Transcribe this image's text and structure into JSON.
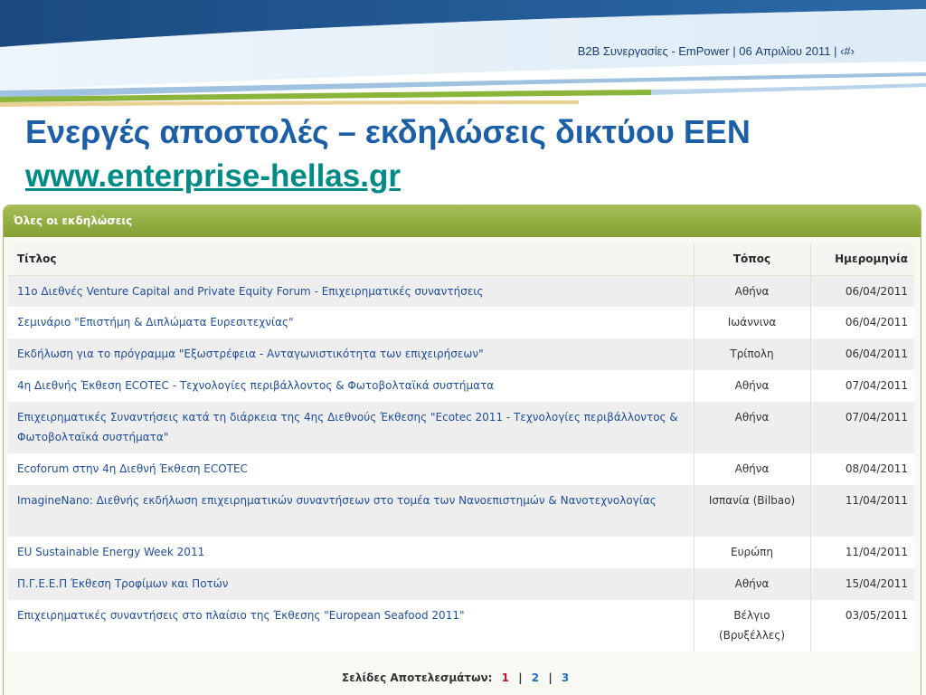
{
  "slide": {
    "header_text": "B2B Συνεργασίες - EmPower  | 06 Απριλίου 2011 | ‹#›",
    "title": "Ενεργές αποστολές – εκδηλώσεις δικτύου ΕΕΝ",
    "link": "www.enterprise-hellas.gr"
  },
  "colors": {
    "title_blue": "#1c5fa6",
    "link_teal": "#008b85",
    "banner_navy": "#1a4a80",
    "banner_green": "#8ab43a",
    "panel_green": "#9bb548",
    "link_blue": "#1f4e99",
    "current_page_red": "#c8102e"
  },
  "panel": {
    "heading": "Όλες οι εκδηλώσεις",
    "columns": [
      "Τίτλος",
      "Τόπος",
      "Ημερομηνία"
    ],
    "rows": [
      {
        "title": "11ο Διεθνές Venture Capital and Private Equity Forum - Επιχειρηματικές συναντήσεις",
        "place": "Αθήνα",
        "date": "06/04/2011"
      },
      {
        "title": "Σεμινάριο \"Επιστήμη & Διπλώματα Ευρεσιτεχνίας\"",
        "place": "Ιωάννινα",
        "date": "06/04/2011"
      },
      {
        "title": "Εκδήλωση για το πρόγραμμα \"Εξωστρέφεια - Ανταγωνιστικότητα των επιχειρήσεων\"",
        "place": "Τρίπολη",
        "date": "06/04/2011"
      },
      {
        "title": "4η Διεθνής Έκθεση ECOTEC - Τεχνολογίες περιβάλλοντος & Φωτοβολταϊκά συστήματα",
        "place": "Αθήνα",
        "date": "07/04/2011"
      },
      {
        "title": "Επιχειρηματικές Συναντήσεις κατά τη διάρκεια της 4ης Διεθνούς Έκθεσης \"Ecotec 2011 - Τεχνολογίες περιβάλλοντος & Φωτοβολταϊκά συστήματα\"",
        "place": "Αθήνα",
        "date": "07/04/2011"
      },
      {
        "title": "Ecoforum στην 4η Διεθνή Έκθεση ECOTEC",
        "place": "Αθήνα",
        "date": "08/04/2011"
      },
      {
        "title": "ImagineNano: Διεθνής εκδήλωση επιχειρηματικών συναντήσεων στο τομέα των Νανοεπιστημών & Νανοτεχνολογίας",
        "place": "Ισπανία (Bilbao)",
        "date": "11/04/2011"
      },
      {
        "title": "EU Sustainable Energy Week 2011",
        "place": "Ευρώπη",
        "date": "11/04/2011"
      },
      {
        "title": "Π.Γ.Ε.Ε.Π Έκθεση Τροφίμων και Ποτών",
        "place": "Αθήνα",
        "date": "15/04/2011"
      },
      {
        "title": "Επιχειρηματικές συναντήσεις στο πλαίσιο της Έκθεσης \"European Seafood 2011\"",
        "place": "Βέλγιο (Βρυξέλλες)",
        "date": "03/05/2011"
      }
    ],
    "pagination": {
      "label": "Σελίδες Αποτελεσμάτων:",
      "pages": [
        "1",
        "2",
        "3"
      ],
      "separator": "|",
      "current": "1"
    }
  }
}
